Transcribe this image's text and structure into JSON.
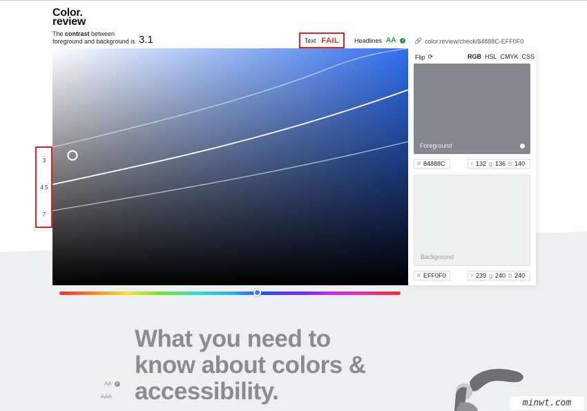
{
  "logo": {
    "line1": "Color.",
    "line2": "review"
  },
  "contrast": {
    "line1_pre": "The ",
    "line1_bold": "contrast",
    "line1_post": " between",
    "line2": "foreground and background is",
    "ratio": "3.1"
  },
  "text_check": {
    "label": "Text",
    "result": "FAIL"
  },
  "headlines_check": {
    "label": "Headlines",
    "result": "AA"
  },
  "link": {
    "url": "color.review/check/84888C-EFF0F0"
  },
  "scale": {
    "labels": [
      "3",
      "4.5",
      "7"
    ]
  },
  "panel": {
    "flip_label": "Flip",
    "modes": [
      "RGB",
      "HSL",
      "CMYK",
      "CSS"
    ],
    "active_mode": "RGB",
    "foreground": {
      "label": "Foreground",
      "hex": "84888C",
      "r": "132",
      "g": "136",
      "b": "140",
      "color": "#84888C"
    },
    "background": {
      "label": "Background",
      "hex": "EFF0F0",
      "r": "239",
      "g": "240",
      "b": "240",
      "color": "#EFF0F0"
    }
  },
  "headline": {
    "line1": "What you need to",
    "line2": "know about colors &",
    "line3": "accessibility."
  },
  "mini": {
    "aa": "AA",
    "aaa": "AAA"
  },
  "watermark": "minwt.com",
  "colors": {
    "fail": "#d93030",
    "pass": "#1f9a4a",
    "accent": "#2f6ef0"
  }
}
